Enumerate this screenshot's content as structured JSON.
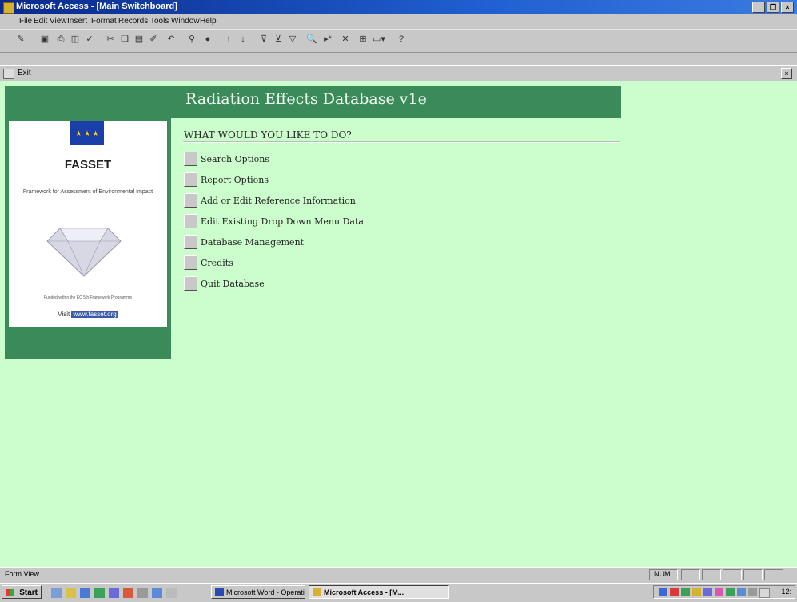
{
  "window": {
    "title": "Microsoft Access - [Main Switchboard]"
  },
  "menu": [
    "File",
    "Edit",
    "View",
    "Insert",
    "Format",
    "Records",
    "Tools",
    "Window",
    "Help"
  ],
  "form_window": {
    "title": "Exit"
  },
  "app": {
    "title": "Radiation Effects Database v1e",
    "prompt": "WHAT WOULD YOU LIKE TO DO?",
    "options": [
      "Search Options",
      "Report Options",
      "Add or Edit Reference Information",
      "Edit Existing Drop Down Menu Data",
      "Database Management",
      "Credits",
      "Quit Database"
    ]
  },
  "logo": {
    "name": "FASSET",
    "subtitle": "Framework for Assessment of Environmental Impact",
    "funded": "Funded within the EC 5th Framework Programme",
    "visit_label": "Visit",
    "visit_url": "www.fasset.org"
  },
  "status": {
    "text": "Form View",
    "num": "NUM"
  },
  "taskbar": {
    "start": "Start",
    "tasks": [
      "Microsoft Word - Operating",
      "Microsoft Access - [M..."
    ],
    "clock": "12:"
  },
  "colors": {
    "form_bg": "#ccfdcc",
    "band": "#3a8a5a",
    "titlebar": "#0a2a8a"
  }
}
